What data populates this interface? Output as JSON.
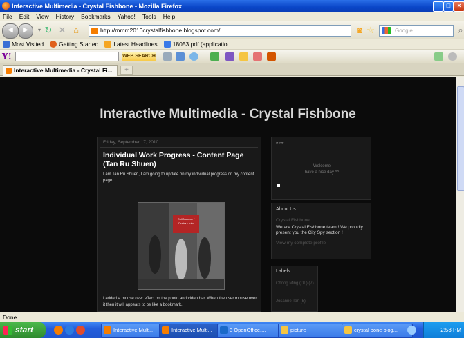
{
  "window": {
    "title": "Interactive Multimedia - Crystal Fishbone - Mozilla Firefox"
  },
  "menu": [
    "File",
    "Edit",
    "View",
    "History",
    "Bookmarks",
    "Yahoo!",
    "Tools",
    "Help"
  ],
  "nav": {
    "url": "http://mmm2010crystalfishbone.blogspot.com/",
    "search_placeholder": "Google"
  },
  "bookmarks": [
    {
      "label": "Most Visited",
      "color": "#3b6fd4"
    },
    {
      "label": "Getting Started",
      "color": "#e0601b"
    },
    {
      "label": "Latest Headlines",
      "color": "#f5a623"
    },
    {
      "label": "18053.pdf (applicatio...",
      "color": "#3a7ae8"
    }
  ],
  "yahoo": {
    "search_value": "",
    "web_search_label": "WEB SEARCH"
  },
  "tabs": [
    {
      "label": "Interactive Multimedia - Crystal Fi..."
    }
  ],
  "page": {
    "blog_title": "Interactive Multimedia - Crystal Fishbone",
    "post": {
      "date": "Friday, September 17, 2010",
      "title": "Individual Work Progress - Content Page (Tan Ru Shuen)",
      "body": "I am Tan Ru Shuen, I am going to update on my individual progress on my content page.",
      "image_label": "Roll Number / Feature Info",
      "body2": "I added a mouse over effect on the photo and video bar. When the user mouse over it then it will appears to be like a bookmark."
    },
    "sidebar": {
      "welcome": {
        "header": "»»»",
        "line1": "Welcome",
        "line2": "have a nice day ^^"
      },
      "about": {
        "header": "About Us",
        "name": "Crystal Fishbone",
        "description": "We are Crystal Fishbone team ! We proudly present you the City Spy section !",
        "profile_link": "View my complete profile"
      },
      "labels": {
        "header": "Labels",
        "items": [
          "Chong Ming (DL) (7)",
          "Josanne Tan (5)"
        ]
      }
    }
  },
  "status": "Done",
  "taskbar": {
    "start": "start",
    "tasks": [
      {
        "label": "Interactive Mult...",
        "color": "#f57d00"
      },
      {
        "label": "Interactive Multi...",
        "color": "#f57d00"
      },
      {
        "label": "3 OpenOffice....",
        "color": "#1b6ac9"
      },
      {
        "label": "picture",
        "color": "#f5c542"
      },
      {
        "label": "crystal bone blog...",
        "color": "#f5c542"
      }
    ],
    "clock": "2:53 PM"
  }
}
